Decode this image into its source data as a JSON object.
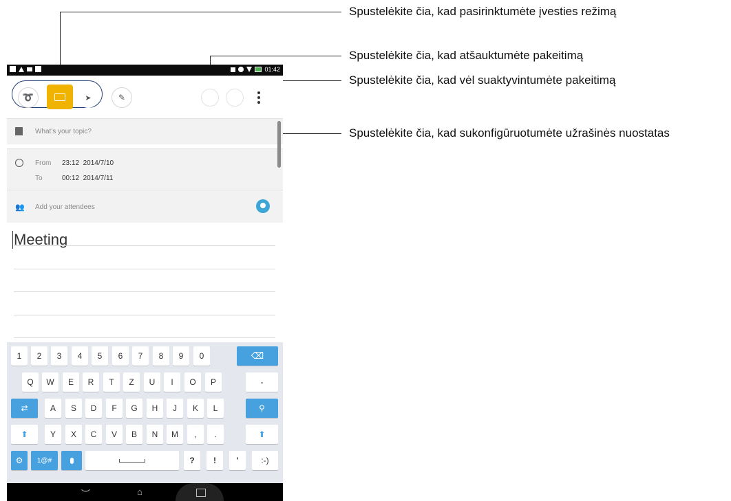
{
  "status_bar": {
    "time": "01:42"
  },
  "editor": {
    "topic_placeholder": "What's your topic?",
    "from_label": "From",
    "from_value": "23:12  2014/7/10",
    "to_label": "To",
    "to_value": "00:12  2014/7/11",
    "attendees_placeholder": "Add your attendees",
    "note_text": "Meeting"
  },
  "keyboard": {
    "row1": [
      "1",
      "2",
      "3",
      "4",
      "5",
      "6",
      "7",
      "8",
      "9",
      "0"
    ],
    "row2": [
      "Q",
      "W",
      "E",
      "R",
      "T",
      "Z",
      "U",
      "I",
      "O",
      "P",
      "-"
    ],
    "row3": [
      "A",
      "S",
      "D",
      "F",
      "G",
      "H",
      "J",
      "K",
      "L"
    ],
    "row4": [
      "Y",
      "X",
      "C",
      "V",
      "B",
      "N",
      "M",
      ",",
      "."
    ],
    "row5": {
      "symbols": "1@#",
      "question": "?",
      "exclaim": "!",
      "apostrophe": "'",
      "smiley": ":-)"
    }
  },
  "callouts": {
    "input_mode": "Spustelėkite čia, kad pasirinktumėte įvesties režimą",
    "undo": "Spustelėkite čia, kad atšauktumėte pakeitimą",
    "redo": "Spustelėkite čia, kad vėl suaktyvintumėte pakeitimą",
    "settings": "Spustelėkite čia, kad sukonfigūruotumėte užrašinės nuostatas"
  },
  "colors": {
    "accent_yellow": "#f0b400",
    "key_blue": "#46a1de",
    "callout_ring": "#223f7a"
  }
}
